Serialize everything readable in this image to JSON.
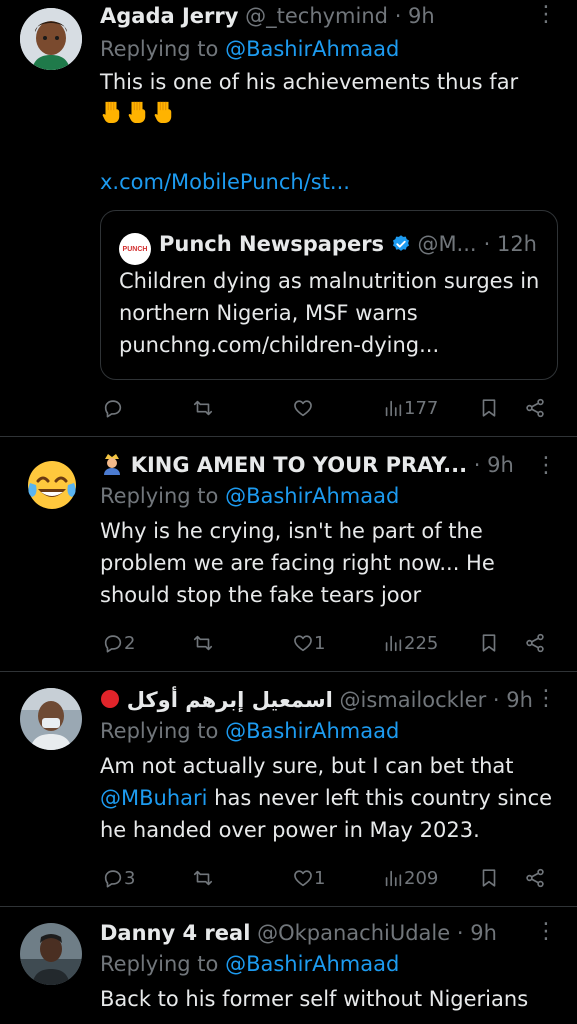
{
  "tweets": [
    {
      "name": "Agada Jerry",
      "handle": "@_techymind",
      "time": "· 9h",
      "replying_prefix": "Replying to ",
      "replying_to": "@BashirAhmaad",
      "text": "This is one of his achievements thus far",
      "link": "x.com/MobilePunch/st...",
      "quote": {
        "logo": "PUNCH",
        "name": "Punch Newspapers",
        "handle": "@M...",
        "time": "· 12h",
        "text": "Children dying as malnutrition surges in northern Nigeria, MSF warns",
        "link": "punchng.com/children-dying..."
      },
      "replies": "",
      "reposts": "",
      "likes": "",
      "views": "177"
    },
    {
      "name": "KING AMEN TO YOUR PRAY...",
      "handle": "",
      "time": "· 9h",
      "replying_prefix": "Replying to ",
      "replying_to": "@BashirAhmaad",
      "text": "Why is he crying, isn't he part of the problem we are facing right now... He should stop the fake tears joor",
      "replies": "2",
      "reposts": "",
      "likes": "1",
      "views": "225"
    },
    {
      "name": "اسمعيل إبرهم أوكل",
      "handle": "@ismailockler",
      "time": "· 9h",
      "replying_prefix": "Replying to ",
      "replying_to": "@BashirAhmaad",
      "text_prefix": "Am not actually sure, but I can bet that ",
      "mention": "@MBuhari",
      "text_suffix": " has never left this country since he handed over power in May 2023.",
      "replies": "3",
      "reposts": "",
      "likes": "1",
      "views": "209"
    },
    {
      "name": "Danny 4 real",
      "handle": "@OkpanachiUdale",
      "time": "· 9h",
      "replying_prefix": "Replying to ",
      "replying_to": "@BashirAhmaad",
      "text": "Back to his former self without Nigerians"
    }
  ],
  "colors": {
    "link": "#1d9bf0",
    "muted": "#71767b",
    "text": "#e7e9ea",
    "verified": "#1d9bf0",
    "background": "#000000"
  },
  "icons": [
    "reply-icon",
    "repost-icon",
    "like-icon",
    "views-icon",
    "bookmark-icon",
    "share-icon",
    "more-icon",
    "verified-badge-icon",
    "pointing-down-emoji",
    "crying-laughing-emoji",
    "person-emoji",
    "red-circle-emoji"
  ]
}
